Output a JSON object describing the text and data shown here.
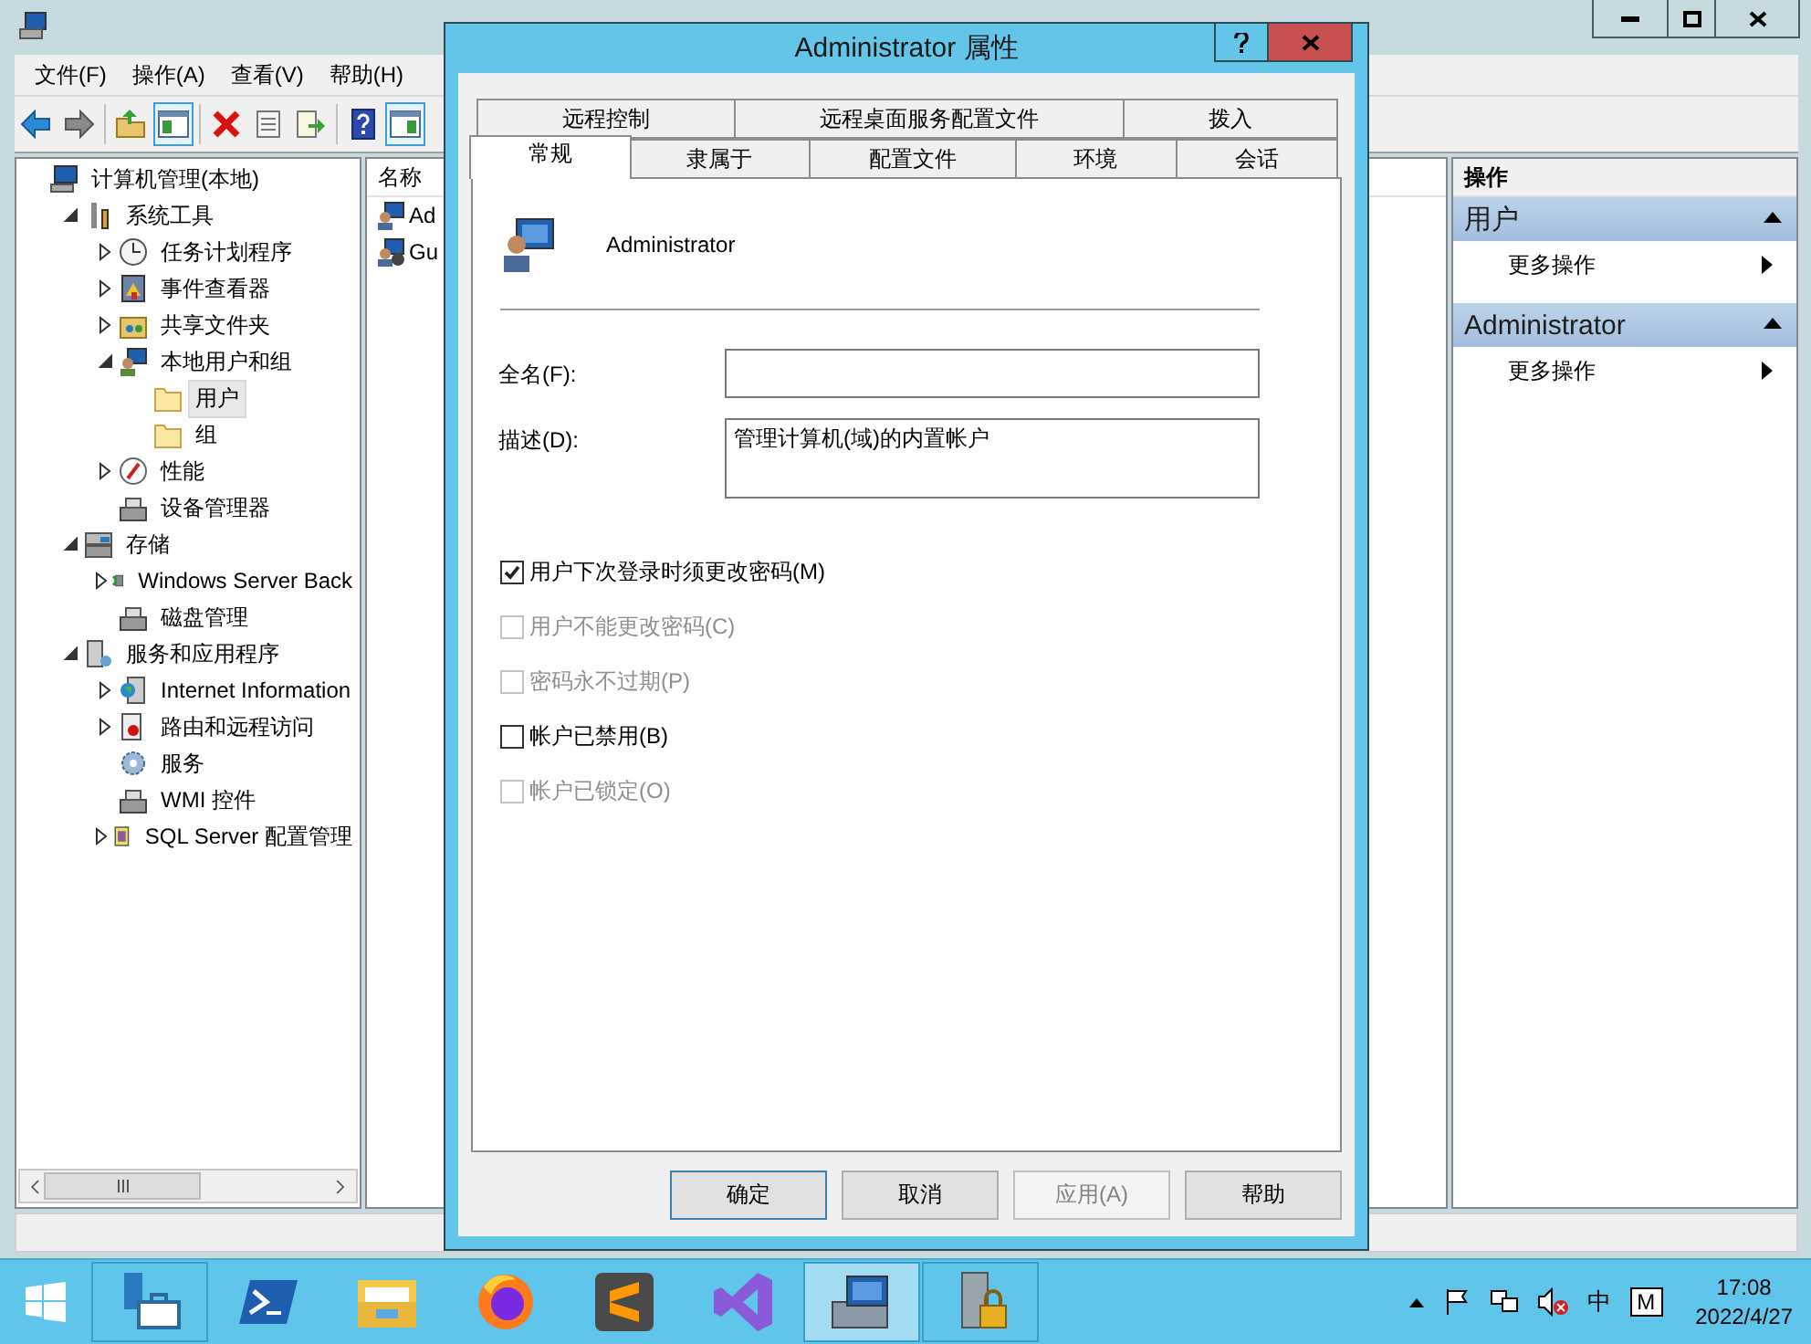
{
  "main_window": {
    "menu": [
      "文件(F)",
      "操作(A)",
      "查看(V)",
      "帮助(H)"
    ],
    "toolbar": [
      {
        "kind": "back",
        "pressed": false
      },
      {
        "kind": "forward",
        "pressed": false
      },
      {
        "kind": "separator"
      },
      {
        "kind": "up",
        "pressed": false
      },
      {
        "kind": "tree-pane",
        "pressed": true
      },
      {
        "kind": "separator"
      },
      {
        "kind": "delete",
        "pressed": false
      },
      {
        "kind": "properties",
        "pressed": false
      },
      {
        "kind": "export",
        "pressed": false
      },
      {
        "kind": "separator"
      },
      {
        "kind": "help",
        "pressed": false
      },
      {
        "kind": "action-pane",
        "pressed": true
      }
    ],
    "tree": [
      {
        "label": "计算机管理(本地)",
        "kind": "computer",
        "selected": false,
        "children": [
          {
            "label": "系统工具",
            "kind": "tools",
            "expanded": true,
            "selected": false,
            "children": [
              {
                "label": "任务计划程序",
                "kind": "clock",
                "expanded": false,
                "selected": false
              },
              {
                "label": "事件查看器",
                "kind": "log",
                "expanded": false,
                "selected": false
              },
              {
                "label": "共享文件夹",
                "kind": "share",
                "expanded": false,
                "selected": false
              },
              {
                "label": "本地用户和组",
                "kind": "users",
                "expanded": true,
                "selected": false,
                "children": [
                  {
                    "label": "用户",
                    "kind": "folder",
                    "selected": true
                  },
                  {
                    "label": "组",
                    "kind": "folder",
                    "selected": false
                  }
                ]
              },
              {
                "label": "性能",
                "kind": "perf",
                "expanded": false,
                "selected": false
              },
              {
                "label": "设备管理器",
                "kind": "device",
                "selected": false
              }
            ]
          },
          {
            "label": "存储",
            "kind": "storage",
            "expanded": true,
            "selected": false,
            "children": [
              {
                "label": "Windows Server Back",
                "kind": "backup",
                "expanded": false,
                "selected": false
              },
              {
                "label": "磁盘管理",
                "kind": "device",
                "selected": false
              }
            ]
          },
          {
            "label": "服务和应用程序",
            "kind": "server",
            "expanded": true,
            "selected": false,
            "children": [
              {
                "label": "Internet Information",
                "kind": "web",
                "expanded": false,
                "selected": false
              },
              {
                "label": "路由和远程访问",
                "kind": "route",
                "expanded": false,
                "selected": false
              },
              {
                "label": "服务",
                "kind": "gear",
                "selected": false
              },
              {
                "label": "WMI 控件",
                "kind": "device",
                "selected": false
              },
              {
                "label": "SQL Server 配置管理",
                "kind": "sql",
                "expanded": false,
                "selected": false
              }
            ]
          }
        ]
      }
    ],
    "list": {
      "columns": [
        "名称"
      ],
      "rows": [
        {
          "name": "Ad",
          "kind": "user"
        },
        {
          "name": "Gu",
          "kind": "guest"
        }
      ]
    },
    "actions": {
      "title": "操作",
      "groups": [
        {
          "title": "用户",
          "items": [
            "更多操作"
          ]
        },
        {
          "title": "Administrator",
          "items": [
            "更多操作"
          ]
        }
      ]
    }
  },
  "dialog": {
    "title": "Administrator 属性",
    "tab_rows": [
      [
        {
          "label": "远程控制",
          "selected": false
        },
        {
          "label": "远程桌面服务配置文件",
          "selected": false
        },
        {
          "label": "拨入",
          "selected": false
        }
      ],
      [
        {
          "label": "常规",
          "selected": true
        },
        {
          "label": "隶属于",
          "selected": false
        },
        {
          "label": "配置文件",
          "selected": false
        },
        {
          "label": "环境",
          "selected": false
        },
        {
          "label": "会话",
          "selected": false
        }
      ]
    ],
    "user_name": "Administrator",
    "fields": [
      {
        "label": "全名(F):",
        "kind": "single"
      },
      {
        "label": "描述(D):",
        "value": "管理计算机(域)的内置帐户",
        "kind": "multiline"
      }
    ],
    "checkboxes": [
      {
        "label": "用户下次登录时须更改密码(M)",
        "checked": true,
        "disabled": false
      },
      {
        "label": "用户不能更改密码(C)",
        "checked": false,
        "disabled": true
      },
      {
        "label": "密码永不过期(P)",
        "checked": false,
        "disabled": true
      },
      {
        "label": "帐户已禁用(B)",
        "checked": false,
        "disabled": false
      },
      {
        "label": "帐户已锁定(O)",
        "checked": false,
        "disabled": true
      }
    ],
    "buttons": [
      {
        "label": "确定",
        "disabled": false,
        "default": true
      },
      {
        "label": "取消",
        "disabled": false,
        "default": false
      },
      {
        "label": "应用(A)",
        "disabled": true,
        "default": false
      },
      {
        "label": "帮助",
        "disabled": false,
        "default": false
      }
    ]
  },
  "taskbar": {
    "apps": [
      {
        "kind": "server-manager",
        "open": true,
        "selected": false
      },
      {
        "kind": "powershell",
        "open": false,
        "selected": false
      },
      {
        "kind": "explorer",
        "open": false,
        "selected": false
      },
      {
        "kind": "firefox",
        "open": false,
        "selected": false
      },
      {
        "kind": "sublime",
        "open": false,
        "selected": false
      },
      {
        "kind": "visual-studio",
        "open": false,
        "selected": false
      },
      {
        "kind": "computer-management",
        "open": true,
        "selected": true
      },
      {
        "kind": "locked-server",
        "open": true,
        "selected": false
      }
    ],
    "language": "中",
    "ime": "M",
    "time": "17:08",
    "date": "2022/4/27"
  }
}
